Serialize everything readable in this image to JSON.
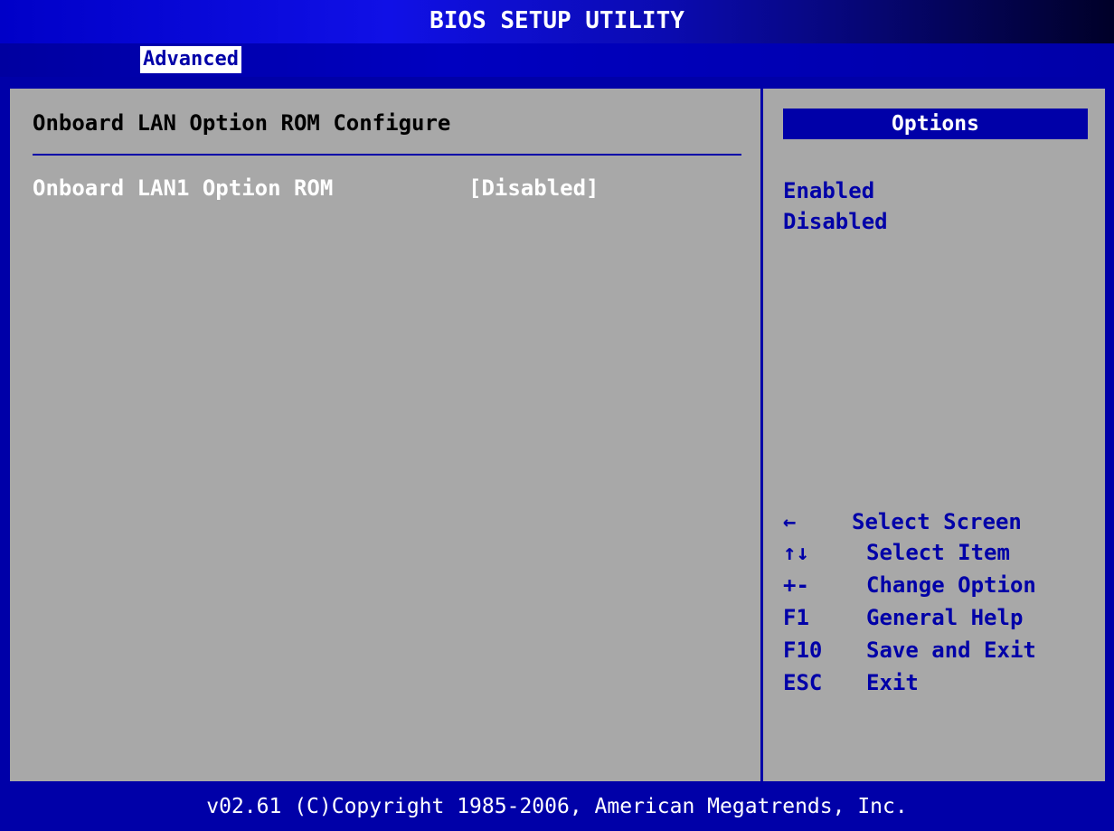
{
  "header": {
    "title": "BIOS SETUP UTILITY",
    "active_tab": "Advanced"
  },
  "main": {
    "section_title": "Onboard LAN Option ROM Configure",
    "settings": [
      {
        "label": "Onboard LAN1 Option ROM",
        "value": "[Disabled]"
      }
    ]
  },
  "help": {
    "header": "Options",
    "options": [
      "Enabled",
      "Disabled"
    ],
    "keys": [
      {
        "key": "←",
        "desc": "Select Screen"
      },
      {
        "key": "↑↓",
        "desc": "Select Item"
      },
      {
        "key": "+-",
        "desc": "Change Option"
      },
      {
        "key": "F1",
        "desc": "General Help"
      },
      {
        "key": "F10",
        "desc": "Save and Exit"
      },
      {
        "key": "ESC",
        "desc": "Exit"
      }
    ]
  },
  "footer": {
    "copyright": "v02.61 (C)Copyright 1985-2006, American Megatrends, Inc."
  },
  "colors": {
    "bios_blue": "#0000a8",
    "panel_gray": "#a8a8a8",
    "highlight_white": "#ffffff"
  }
}
